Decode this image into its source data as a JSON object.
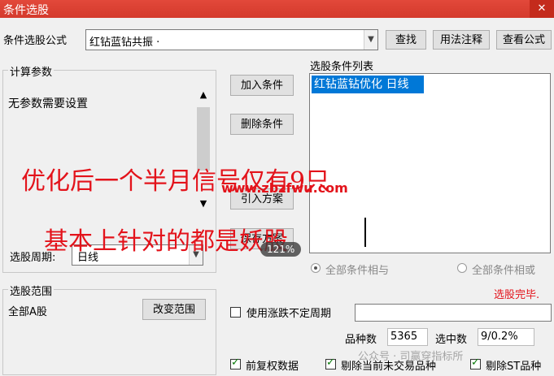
{
  "window": {
    "title": "条件选股",
    "close_label": "✕"
  },
  "formula": {
    "label": "条件选股公式",
    "value": "红钻蓝钻共振  ·",
    "buttons": {
      "find": "查找",
      "usage": "用法注释",
      "view": "查看公式"
    }
  },
  "params": {
    "legend": "计算参数",
    "text": "无参数需要设置"
  },
  "actions": {
    "add": "加入条件",
    "remove": "删除条件",
    "import": "引入方案",
    "save": "保存方案"
  },
  "conditions": {
    "label": "选股条件列表",
    "items": [
      "红钻蓝钻优化  日线"
    ]
  },
  "period": {
    "label": "选股周期:",
    "value": "日线"
  },
  "logic": {
    "and_label": "全部条件相与",
    "or_label": "全部条件相或",
    "selected": "and"
  },
  "status": {
    "done": "选股完毕.",
    "done_color": "#e3131b"
  },
  "scope": {
    "legend": "选股范围",
    "value": "全部A股",
    "change_button": "改变范围"
  },
  "uncertain_period": {
    "label": "使用涨跌不定周期",
    "checked": false
  },
  "counts": {
    "total_label": "品种数",
    "total_value": "5365",
    "selected_label": "选中数",
    "selected_value": "9/0.2%"
  },
  "options": {
    "pre_adjust": {
      "label": "前复权数据",
      "checked": true
    },
    "remove_untraded": {
      "label": "剔除当前未交易品种",
      "checked": true
    },
    "remove_st": {
      "label": "剔除ST品种",
      "checked": true
    }
  },
  "overlay": {
    "line1": "优化后一个半月信号仅有9只",
    "line2": "基本上针对的都是妖股",
    "watermark": "www.zbzfwu.com",
    "zoom_badge": "121%",
    "wechat_mark": "公众号 · 司赢穿指标所"
  }
}
